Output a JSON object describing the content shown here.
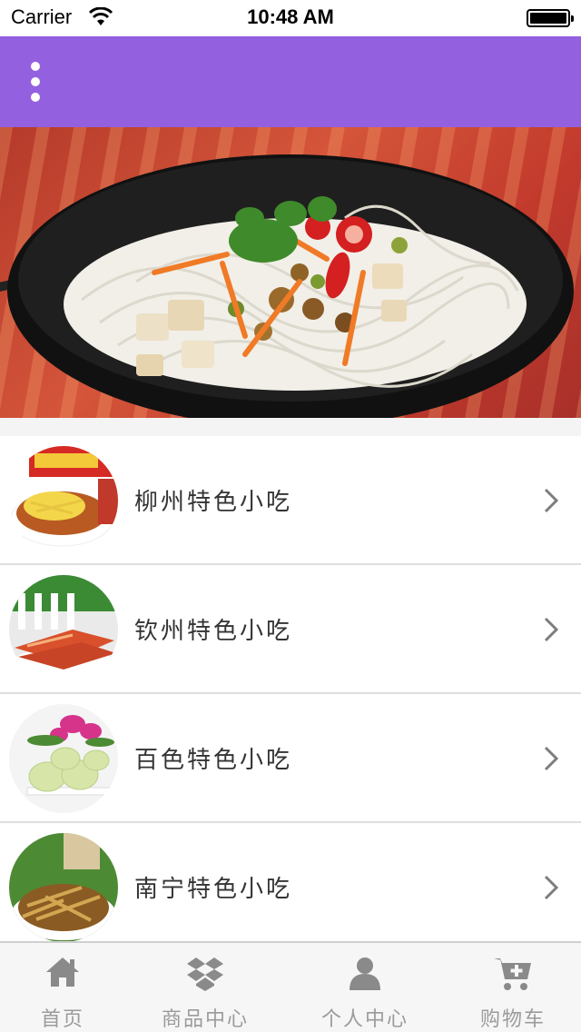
{
  "status_bar": {
    "carrier": "Carrier",
    "time": "10:48 AM"
  },
  "header": {
    "menu_icon": "vertical-dots-icon",
    "background_color": "#9360df"
  },
  "banner": {
    "image": "rice-noodle-bowl",
    "slides": 3,
    "active_slide": 1
  },
  "list": {
    "items": [
      {
        "label": "柳州特色小吃",
        "thumb": "luosifen-package"
      },
      {
        "label": "钦州特色小吃",
        "thumb": "dried-meat-slices"
      },
      {
        "label": "百色特色小吃",
        "thumb": "steamed-buns"
      },
      {
        "label": "南宁特色小吃",
        "thumb": "pickled-bamboo-bowl"
      }
    ]
  },
  "tab_bar": {
    "tabs": [
      {
        "label": "首页",
        "icon": "home-icon"
      },
      {
        "label": "商品中心",
        "icon": "dropbox-icon"
      },
      {
        "label": "个人中心",
        "icon": "user-icon"
      },
      {
        "label": "购物车",
        "icon": "cart-plus-icon"
      }
    ]
  }
}
